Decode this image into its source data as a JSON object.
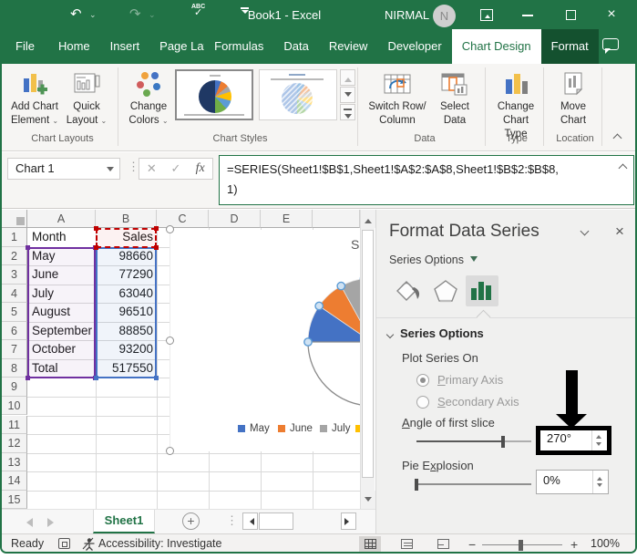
{
  "window": {
    "title": "Book1 - Excel",
    "user_name": "NIRMAL",
    "avatar_initial": "N",
    "abc_label": "ABC"
  },
  "tabs": [
    {
      "label": "File",
      "state": "file"
    },
    {
      "label": "Home"
    },
    {
      "label": "Insert"
    },
    {
      "label": "Page Layout",
      "state": "clip"
    },
    {
      "label": "Formulas"
    },
    {
      "label": "Data"
    },
    {
      "label": "Review"
    },
    {
      "label": "Developer"
    },
    {
      "label": "Chart Design",
      "state": "active"
    },
    {
      "label": "Format",
      "state": "dark"
    },
    {
      "label": "Tell me",
      "state": "tellme"
    }
  ],
  "ribbon": {
    "add_chart_element": {
      "line1": "Add Chart",
      "line2": "Element"
    },
    "quick_layout": {
      "line1": "Quick",
      "line2": "Layout"
    },
    "change_colors": {
      "line1": "Change",
      "line2": "Colors"
    },
    "switch_row_column": {
      "line1": "Switch Row/",
      "line2": "Column"
    },
    "select_data": {
      "line1": "Select",
      "line2": "Data"
    },
    "change_chart_type": {
      "line1": "Change",
      "line2": "Chart Type"
    },
    "move_chart": {
      "line1": "Move",
      "line2": "Chart"
    },
    "groups": {
      "chart_layouts": "Chart Layouts",
      "chart_styles": "Chart Styles",
      "data": "Data",
      "type": "Type",
      "location": "Location"
    }
  },
  "formula_bar": {
    "name_box": "Chart 1",
    "fx_label": "fx",
    "cancel_label": "✕",
    "enter_label": "✓",
    "formula_line1": "=SERIES(Sheet1!$B$1,Sheet1!$A$2:$A$8,Sheet1!$B$2:$B$8,",
    "formula_line2": "1)"
  },
  "sheet": {
    "columns": [
      "A",
      "B",
      "C",
      "D",
      "E"
    ],
    "row_count": 15,
    "rows": [
      {
        "row": 1,
        "A": "Month",
        "B": "Sales"
      },
      {
        "row": 2,
        "A": "May",
        "B": "98660"
      },
      {
        "row": 3,
        "A": "June",
        "B": "77290"
      },
      {
        "row": 4,
        "A": "July",
        "B": "63040"
      },
      {
        "row": 5,
        "A": "August",
        "B": "96510"
      },
      {
        "row": 6,
        "A": "September",
        "B": "88850"
      },
      {
        "row": 7,
        "A": "October",
        "B": "93200"
      },
      {
        "row": 8,
        "A": "Total",
        "B": "517550"
      }
    ]
  },
  "chart_data": {
    "type": "pie",
    "title": "Sales",
    "categories": [
      "May",
      "June",
      "July",
      "August",
      "September",
      "October",
      "Total"
    ],
    "values": [
      98660,
      77290,
      63040,
      96510,
      88850,
      93200,
      517550
    ],
    "colors": [
      "#4472c4",
      "#ed7d31",
      "#a5a5a5",
      "#ffc000",
      "#5b9bd5",
      "#70ad47",
      "#ffffff"
    ],
    "angle_of_first_slice_deg": 270,
    "legend_position": "bottom",
    "legend_visible_labels": [
      "May",
      "June",
      "July",
      "August"
    ],
    "legend_colors": [
      "#4472c4",
      "#ed7d31",
      "#a5a5a5",
      "#ffc000"
    ]
  },
  "pane": {
    "title": "Format Data Series",
    "series_options_dropdown": "Series Options",
    "section_header": "Series Options",
    "plot_series_on": "Plot Series On",
    "primary_axis": "Primary Axis",
    "secondary_axis": "Secondary Axis",
    "angle_label": "Angle of first slice",
    "angle_value": "270°",
    "angle_slider_fraction": 0.75,
    "explosion_label": "Pie Explosion",
    "explosion_value": "0%",
    "explosion_slider_fraction": 0
  },
  "sheet_tabs": {
    "active_tab": "Sheet1"
  },
  "status_bar": {
    "ready": "Ready",
    "accessibility": "Accessibility: Investigate",
    "zoom_level": "100%"
  }
}
